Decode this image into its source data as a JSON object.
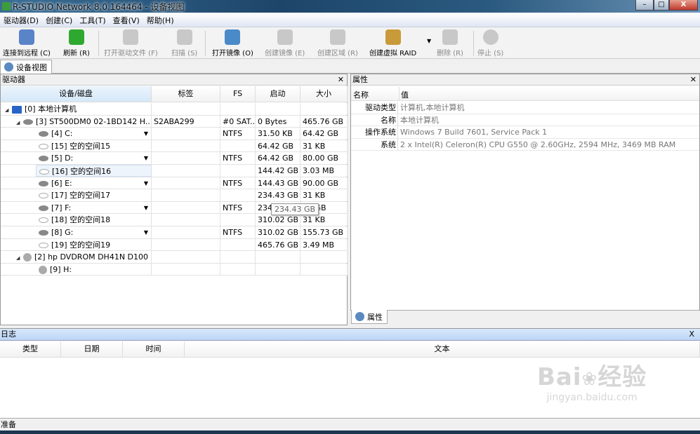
{
  "window": {
    "title": "R-STUDIO Network 8.0.164464 - 设备视图",
    "min": "–",
    "max": "□",
    "close": "X"
  },
  "menu": [
    "驱动器(D)",
    "创建(C)",
    "工具(T)",
    "查看(V)",
    "帮助(H)"
  ],
  "toolbar": [
    {
      "label": "连接到远程 (C)",
      "icon": "remote-computer-icon",
      "enabled": true,
      "color": "#5a84c8"
    },
    {
      "label": "刷新 (R)",
      "icon": "refresh-icon",
      "enabled": true,
      "color": "#2fa82f"
    },
    {
      "label": "打开驱动文件 (F)",
      "icon": "open-drive-file-icon",
      "enabled": false
    },
    {
      "label": "扫描 (S)",
      "icon": "scan-icon",
      "enabled": false
    },
    {
      "label": "打开镜像 (O)",
      "icon": "open-image-icon",
      "enabled": true,
      "color": "#4a8ac8"
    },
    {
      "label": "创建镜像 (E)",
      "icon": "create-image-icon",
      "enabled": false
    },
    {
      "label": "创建区域 (R)",
      "icon": "create-region-icon",
      "enabled": false
    },
    {
      "label": "创建虚拟 RAID",
      "icon": "raid-icon",
      "enabled": true,
      "color": "#c89a3a"
    },
    {
      "label": "删除 (R)",
      "icon": "delete-icon",
      "enabled": false
    },
    {
      "label": "停止 (S)",
      "icon": "stop-icon",
      "enabled": false
    }
  ],
  "tabs": {
    "main": "设备视图",
    "properties": "属性"
  },
  "drives": {
    "title": "驱动器",
    "close": "✕",
    "columns": [
      "设备/磁盘",
      "标签",
      "FS",
      "启动",
      "大小"
    ],
    "rows": [
      {
        "level": 0,
        "icon": "pc",
        "name": "[0] 本地计算机",
        "label": "",
        "fs": "",
        "start": "",
        "size": "",
        "expander": "◢"
      },
      {
        "level": 1,
        "icon": "disk",
        "name": "[3] ST500DM0 02-1BD142 H...",
        "label": "S2ABA299",
        "fs": "#0 SAT...",
        "start": "0 Bytes",
        "size": "465.76 GB",
        "expander": "◢"
      },
      {
        "level": 2,
        "icon": "disk",
        "name": "[4] C:",
        "label": "",
        "fs": "NTFS",
        "start": "31.50 KB",
        "size": "64.42 GB",
        "dropdown": "▼"
      },
      {
        "level": 2,
        "icon": "free",
        "name": "[15] 空的空间15",
        "label": "",
        "fs": "",
        "start": "64.42 GB",
        "size": "31 KB"
      },
      {
        "level": 2,
        "icon": "disk",
        "name": "[5] D:",
        "label": "",
        "fs": "NTFS",
        "start": "64.42 GB",
        "size": "80.00 GB",
        "dropdown": "▼"
      },
      {
        "level": 2,
        "icon": "free",
        "name": "[16] 空的空间16",
        "label": "",
        "fs": "",
        "start": "144.42 GB",
        "size": "3.03 MB",
        "selected": true
      },
      {
        "level": 2,
        "icon": "disk",
        "name": "[6] E:",
        "label": "",
        "fs": "NTFS",
        "start": "144.43 GB",
        "size": "90.00 GB",
        "dropdown": "▼"
      },
      {
        "level": 2,
        "icon": "free",
        "name": "[17] 空的空间17",
        "label": "",
        "fs": "",
        "start": "234.43 GB",
        "size": "31 KB"
      },
      {
        "level": 2,
        "icon": "disk",
        "name": "[7] F:",
        "label": "",
        "fs": "NTFS",
        "start": "234",
        "size": "59 GB",
        "dropdown": "▼"
      },
      {
        "level": 2,
        "icon": "free",
        "name": "[18] 空的空间18",
        "label": "",
        "fs": "",
        "start": "310.02 GB",
        "size": "31 KB"
      },
      {
        "level": 2,
        "icon": "disk",
        "name": "[8] G:",
        "label": "",
        "fs": "NTFS",
        "start": "310.02 GB",
        "size": "155.73 GB",
        "dropdown": "▼"
      },
      {
        "level": 2,
        "icon": "free",
        "name": "[19] 空的空间19",
        "label": "",
        "fs": "",
        "start": "465.76 GB",
        "size": "3.49 MB"
      },
      {
        "level": 1,
        "icon": "cd",
        "name": "[2] hp DVDROM DH41N D100",
        "label": "",
        "fs": "",
        "start": "",
        "size": "",
        "expander": "◢"
      },
      {
        "level": 2,
        "icon": "cd",
        "name": "[9] H:",
        "label": "",
        "fs": "",
        "start": "",
        "size": ""
      }
    ],
    "tooltip": "234.43 GB"
  },
  "properties": {
    "title": "属性",
    "close": "✕",
    "columns": [
      "名称",
      "值"
    ],
    "rows": [
      {
        "key": "驱动类型",
        "value": "计算机,本地计算机"
      },
      {
        "key": "名称",
        "value": "本地计算机"
      },
      {
        "key": "操作系统",
        "value": "Windows 7 Build 7601, Service Pack 1"
      },
      {
        "key": "系统",
        "value": "2 x Intel(R) Celeron(R) CPU G550 @ 2.60GHz, 2594 MHz, 3469 MB RAM"
      }
    ]
  },
  "log": {
    "title": "日志",
    "close": "X",
    "columns": [
      "类型",
      "日期",
      "时间",
      "文本"
    ]
  },
  "status": "准备",
  "watermark": {
    "logo": "Bai du 经验",
    "url": "jingyan.baidu.com"
  }
}
